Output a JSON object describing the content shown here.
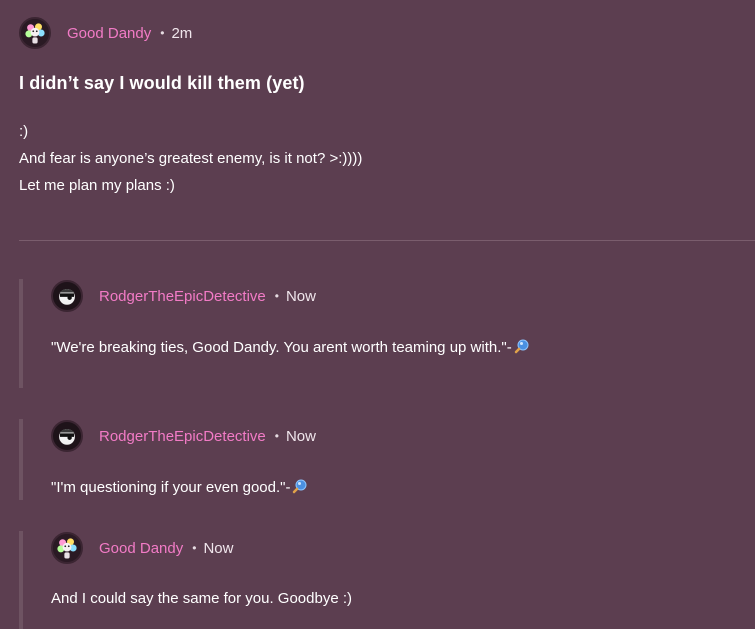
{
  "post": {
    "author": "Good Dandy",
    "separator": "•",
    "time": "2m",
    "title": "I didn’t say I would kill them (yet)",
    "body_lines": [
      ":)",
      "And fear is anyone’s greatest enemy, is it not? >:))))",
      "Let me plan my plans :)"
    ]
  },
  "replies": [
    {
      "author": "RodgerTheEpicDetective",
      "separator": "•",
      "time": "Now",
      "text": "\"We're breaking ties, Good Dandy. You arent worth teaming up with.\"-",
      "emoji": "magnifying-glass-icon"
    },
    {
      "author": "RodgerTheEpicDetective",
      "separator": "•",
      "time": "Now",
      "text": "\"I'm questioning if your even good.\"-",
      "emoji": "magnifying-glass-icon"
    },
    {
      "author": "Good Dandy",
      "separator": "•",
      "time": "Now",
      "text": "And I could say the same for you. Goodbye :)"
    }
  ],
  "colors": {
    "background": "#5c3e50",
    "username": "#f27bc6",
    "text": "#ffffff",
    "thread_bar": "#6e5362"
  }
}
